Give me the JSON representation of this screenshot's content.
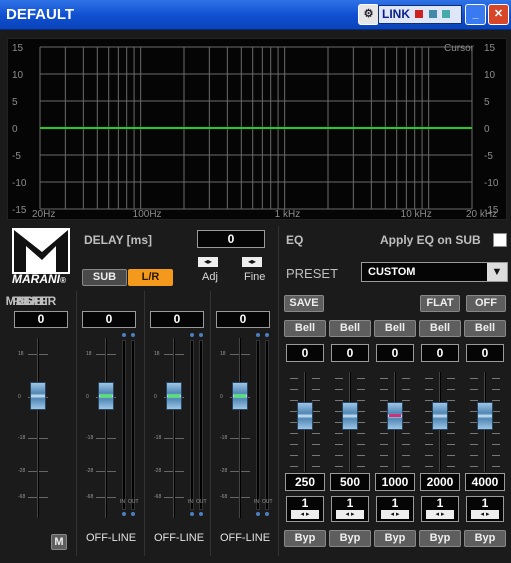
{
  "window": {
    "title": "DEFAULT",
    "link_label": "LINK"
  },
  "graph": {
    "cursor_label": "Cursor",
    "y_ticks": [
      "15",
      "10",
      "5",
      "0",
      "-5",
      "-10",
      "-15"
    ],
    "x_ticks": [
      "20Hz",
      "100Hz",
      "1 kHz",
      "10 kHz",
      "20 kHz"
    ],
    "curve_color": "#22cc22"
  },
  "brand": {
    "name": "MARANI",
    "reg": "®"
  },
  "delay": {
    "label": "DELAY [ms]",
    "value": "0",
    "sub_btn": "SUB",
    "lr_btn": "L/R",
    "adj": "Adj",
    "fine": "Fine"
  },
  "channels": {
    "master": {
      "label": "MASTER",
      "value": "0",
      "mute": "M"
    },
    "sub": {
      "label": "SUB",
      "value": "0",
      "status": "OFF-LINE"
    },
    "left": {
      "label": "LEFT",
      "value": "0",
      "status": "OFF-LINE"
    },
    "right": {
      "label": "RIGHT",
      "value": "0",
      "status": "OFF-LINE"
    }
  },
  "scale": [
    "18",
    "0",
    "-18",
    "-28",
    "-68"
  ],
  "meter_labels": {
    "in": "IN",
    "out": "OUT"
  },
  "eq": {
    "label": "EQ",
    "apply_sub": "Apply EQ on SUB",
    "preset_label": "PRESET",
    "preset_value": "CUSTOM",
    "save": "SAVE",
    "flat": "FLAT",
    "off": "OFF",
    "bands": [
      {
        "type": "Bell",
        "gain": "0",
        "freq": "250",
        "q": "1",
        "byp": "Byp"
      },
      {
        "type": "Bell",
        "gain": "0",
        "freq": "500",
        "q": "1",
        "byp": "Byp"
      },
      {
        "type": "Bell",
        "gain": "0",
        "freq": "1000",
        "q": "1",
        "byp": "Byp"
      },
      {
        "type": "Bell",
        "gain": "0",
        "freq": "2000",
        "q": "1",
        "byp": "Byp"
      },
      {
        "type": "Bell",
        "gain": "0",
        "freq": "4000",
        "q": "1",
        "byp": "Byp"
      }
    ]
  }
}
